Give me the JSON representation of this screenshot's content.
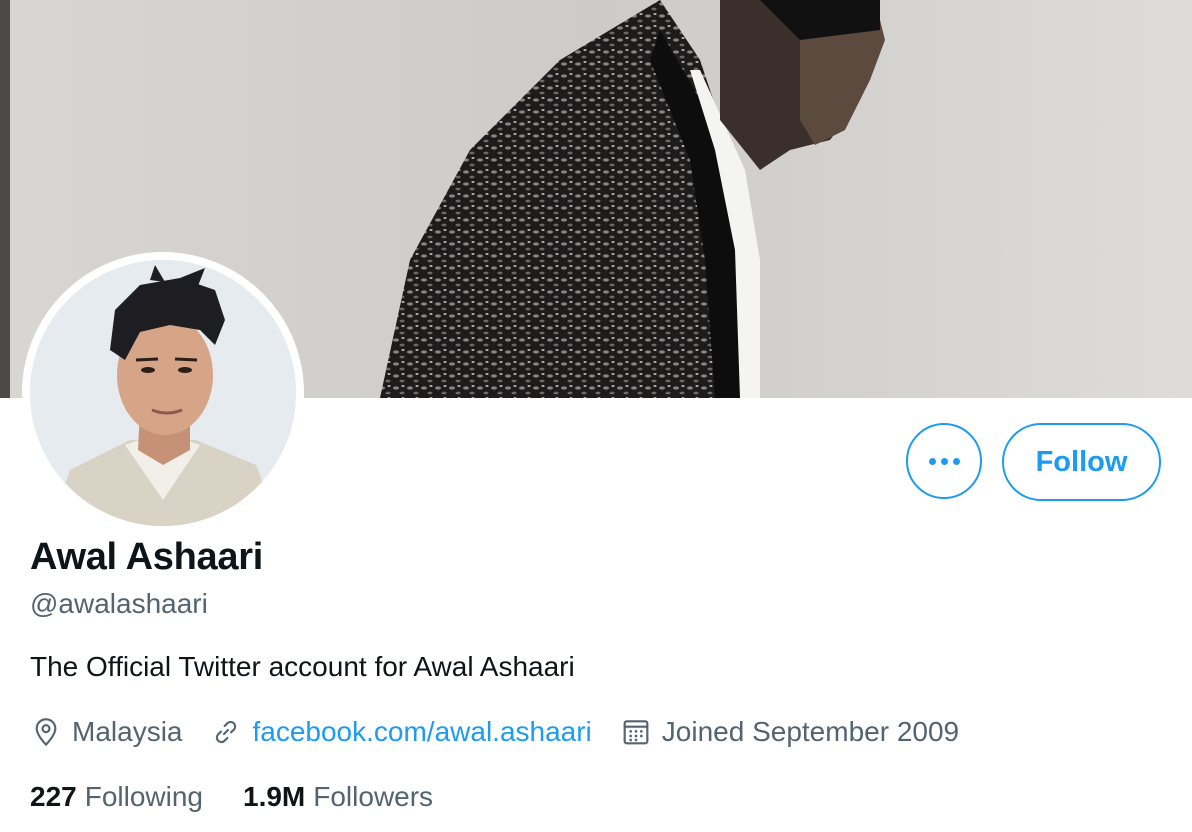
{
  "profile": {
    "name": "Awal Ashaari",
    "handle": "@awalashaari",
    "bio": "The Official Twitter account for Awal Ashaari",
    "location": "Malaysia",
    "website": "facebook.com/awal.ashaari",
    "joined": "Joined September 2009"
  },
  "stats": {
    "following_count": "227",
    "following_label": "Following",
    "followers_count": "1.9M",
    "followers_label": "Followers"
  },
  "actions": {
    "follow_label": "Follow",
    "more_icon": "more-horizontal-icon"
  },
  "icons": {
    "location": "location-pin-icon",
    "link": "link-icon",
    "calendar": "calendar-icon"
  },
  "colors": {
    "accent": "#1d9bf0",
    "text_primary": "#0f1419",
    "text_secondary": "#536471"
  }
}
